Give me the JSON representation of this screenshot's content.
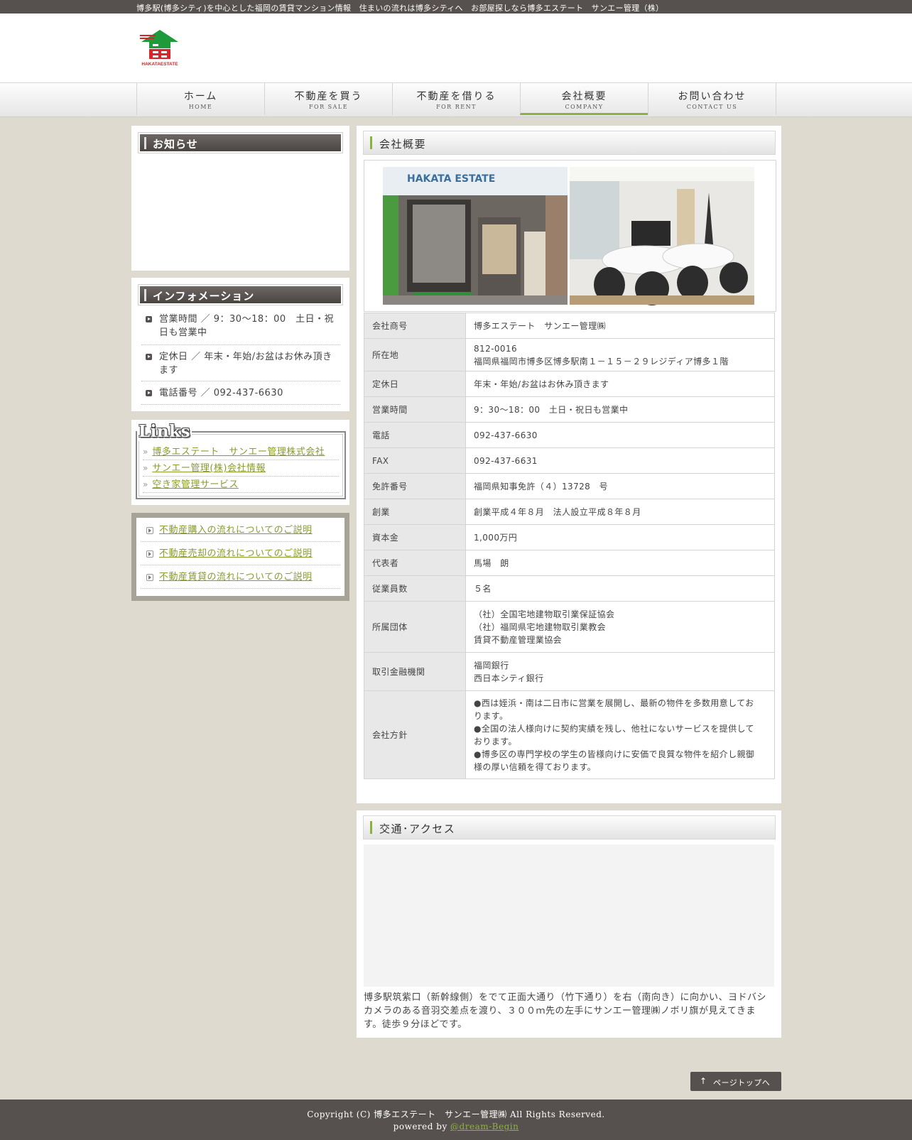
{
  "topbar": {
    "text": "博多駅(博多シティ)を中心とした福岡の賃貸マンション情報　住まいの流れは博多シティへ　お部屋探しなら博多エステート　サンエー管理（株）"
  },
  "logo": {
    "text": "HAKATAESTATE"
  },
  "nav": {
    "items": [
      {
        "jp": "ホーム",
        "en": "HOME"
      },
      {
        "jp": "不動産を買う",
        "en": "FOR SALE"
      },
      {
        "jp": "不動産を借りる",
        "en": "FOR RENT"
      },
      {
        "jp": "会社概要",
        "en": "COMPANY"
      },
      {
        "jp": "お問い合わせ",
        "en": "CONTACT US"
      }
    ],
    "active": "COMPANY"
  },
  "sidebar": {
    "news_title": "お知らせ",
    "info_title": "インフォメーション",
    "info_items": [
      {
        "line1": "営業時間 ／ 9：30～18：00　土日・祝",
        "line2": "日も営業中"
      },
      {
        "line1": "定休日 ／ 年末・年始/お盆はお休み頂き",
        "line2": "ます"
      },
      {
        "line1": "電話番号 ／ 092-437-6630",
        "line2": ""
      }
    ],
    "links_title": "Links",
    "links": [
      "博多エステート　サンエー管理株式会社",
      "サンエー管理(株)会社情報",
      "空き家管理サービス"
    ],
    "flow_links": [
      "不動産購入の流れについてのご説明",
      "不動産売却の流れについてのご説明",
      "不動産賃貸の流れについてのご説明"
    ]
  },
  "company": {
    "title": "会社概要",
    "sign_text": "HAKATA ESTATE",
    "rows": [
      {
        "label": "会社商号",
        "lines": [
          "博多エステート　サンエー管理㈱"
        ]
      },
      {
        "label": "所在地",
        "lines": [
          "812-0016",
          "福岡県福岡市博多区博多駅南１－１５－２９レジディア博多１階"
        ]
      },
      {
        "label": "定休日",
        "lines": [
          "年末・年始/お盆はお休み頂きます"
        ]
      },
      {
        "label": "営業時間",
        "lines": [
          "9：30～18：00　土日・祝日も営業中"
        ]
      },
      {
        "label": "電話",
        "lines": [
          "092-437-6630"
        ]
      },
      {
        "label": "FAX",
        "lines": [
          "092-437-6631"
        ]
      },
      {
        "label": "免許番号",
        "lines": [
          "福岡県知事免許（４）13728　号"
        ]
      },
      {
        "label": "創業",
        "lines": [
          "創業平成４年８月　法人設立平成８年８月"
        ]
      },
      {
        "label": "資本金",
        "lines": [
          "1,000万円"
        ]
      },
      {
        "label": "代表者",
        "lines": [
          "馬場　朗"
        ]
      },
      {
        "label": "従業員数",
        "lines": [
          "５名"
        ]
      },
      {
        "label": "所属団体",
        "lines": [
          "（社）全国宅地建物取引業保証協会",
          "（社）福岡県宅地建物取引業教会",
          "賃貸不動産管理業協会"
        ]
      },
      {
        "label": "取引金融機関",
        "lines": [
          "福岡銀行",
          "西日本シティ銀行"
        ]
      },
      {
        "label": "会社方針",
        "lines": [
          "●西は姪浜・南は二日市に営業を展開し、最新の物件を多数用意してお",
          "ります。",
          "●全国の法人様向けに契約実績を残し、他社にないサービスを提供して",
          "おります。",
          "●博多区の専門学校の学生の皆様向けに安価で良質な物件を紹介し親御",
          "様の厚い信頼を得ております。"
        ]
      }
    ]
  },
  "access": {
    "title": "交通･アクセス",
    "text_lines": [
      "博多駅筑紫口（新幹線側）をでて正面大通り（竹下通り）を右（南向き）に向かい、ヨドバシ",
      "カメラのある音羽交差点を渡り、３００ｍ先の左手にサンエー管理㈱ノボリ旗が見えてきま",
      "す。徒歩９分ほどです。"
    ]
  },
  "pagetop": {
    "arrow": "↑",
    "label": "ページトップへ"
  },
  "footer": {
    "copyright": "Copyright (C) 博多エステート　サンエー管理㈱ All Rights Reserved.",
    "powered_prefix": "powered by ",
    "powered_link": "@dream-Begin"
  },
  "colors": {
    "accent": "#8db13f",
    "dark": "#56514f",
    "background": "#dedad0",
    "link": "#8a9b2c"
  }
}
